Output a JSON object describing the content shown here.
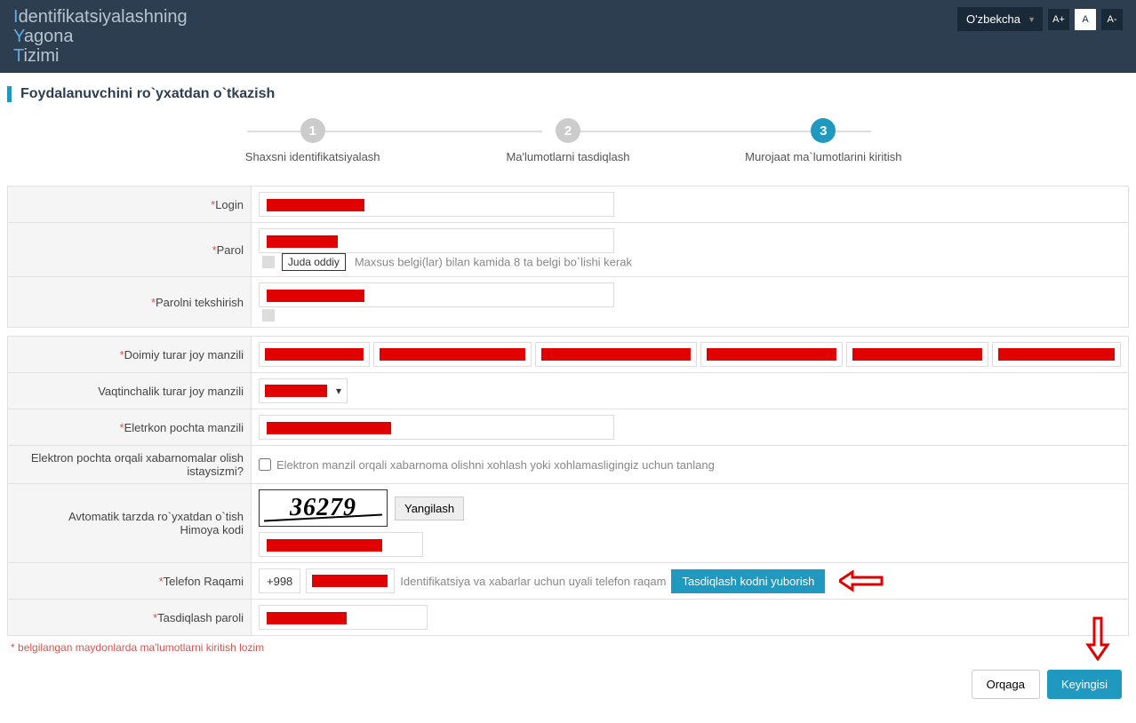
{
  "header": {
    "logo_line1_letter": "I",
    "logo_line1_rest": "dentifikatsiyalashning",
    "logo_line2_letter": "Y",
    "logo_line2_rest": "agona",
    "logo_line3_letter": "T",
    "logo_line3_rest": "izimi",
    "language": "O'zbekcha",
    "font_plus": "A+",
    "font_normal": "A",
    "font_minus": "A-"
  },
  "page": {
    "title": "Foydalanuvchini ro`yxatdan o`tkazish"
  },
  "steps": {
    "s1": "Shaxsni identifikatsiyalash",
    "s2": "Ma'lumotlarni tasdiqlash",
    "s3": "Murojaat ma`lumotlarini kiritish"
  },
  "labels": {
    "login": "Login",
    "password": "Parol",
    "password_confirm": "Parolni tekshirish",
    "perm_address": "Doimiy turar joy manzili",
    "temp_address": "Vaqtinchalik turar joy manzili",
    "email": "Eletrkon pochta manzili",
    "newsletter": "Elektron pochta orqali xabarnomalar olish istaysizmi?",
    "captcha_line1": "Avtomatik tarzda ro`yxatdan o`tish",
    "captcha_line2": "Himoya kodi",
    "phone": "Telefon Raqami",
    "confirm_code": "Tasdiqlash paroli"
  },
  "fields": {
    "strength_label": "Juda oddiy",
    "strength_hint": "Maxsus belgi(lar) bilan kamida 8 ta belgi bo`lishi kerak",
    "newsletter_hint": "Elektron manzil orqali xabarnoma olishni xohlash yoki xohlamasligingiz uchun tanlang",
    "captcha_value": "36279",
    "refresh": "Yangilash",
    "phone_prefix": "+998",
    "phone_hint": "Identifikatsiya va xabarlar uchun uyali telefon raqam",
    "send_code": "Tasdiqlash kodni yuborish"
  },
  "footer": {
    "note": "belgilangan maydonlarda ma'lumotlarni kiritish lozim",
    "back": "Orqaga",
    "next": "Keyingisi"
  }
}
